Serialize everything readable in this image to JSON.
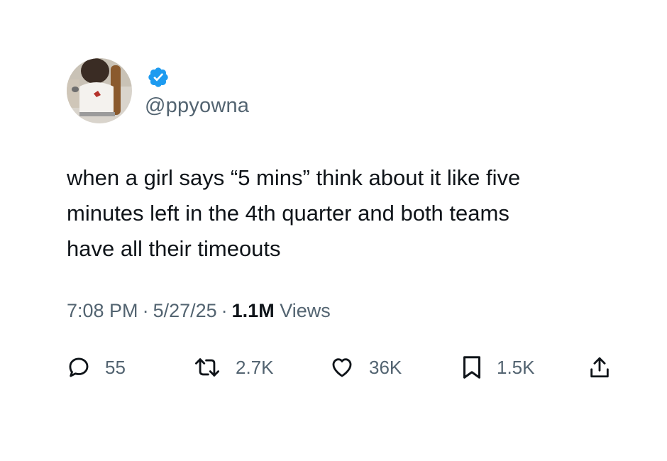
{
  "user": {
    "handle": "@ppyowna",
    "verified": true,
    "verified_color": "#1d9bf0",
    "avatar_icon": "profile-photo"
  },
  "tweet": {
    "text": "when a girl says “5 mins” think about it like five\nminutes left in the 4th quarter and both teams\nhave all their timeouts",
    "time": "7:08 PM",
    "date": "5/27/25",
    "views_count": "1.1M",
    "views_label": "Views",
    "separator": "·"
  },
  "actions": {
    "reply": {
      "icon": "reply-bubble-icon",
      "count": "55"
    },
    "retweet": {
      "icon": "retweet-arrows-icon",
      "count": "2.7K"
    },
    "like": {
      "icon": "heart-icon",
      "count": "36K"
    },
    "bookmark": {
      "icon": "bookmark-icon",
      "count": "1.5K"
    },
    "share": {
      "icon": "share-upload-icon"
    }
  },
  "colors": {
    "text": "#0f1419",
    "secondary": "#536471",
    "background": "#ffffff"
  }
}
